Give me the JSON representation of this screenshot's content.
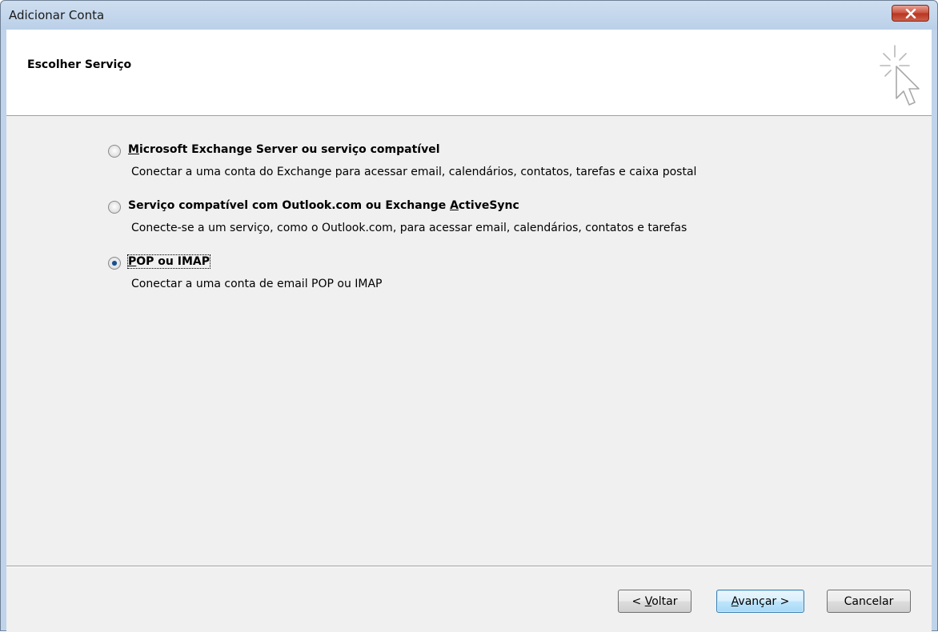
{
  "window": {
    "title": "Adicionar Conta"
  },
  "header": {
    "title": "Escolher Serviço"
  },
  "options": [
    {
      "label_pre": "",
      "label_key": "M",
      "label_post": "icrosoft Exchange Server ou serviço compatível",
      "description": "Conectar a uma conta do Exchange para acessar email, calendários, contatos, tarefas e caixa postal",
      "checked": false
    },
    {
      "label_pre": "Serviço compatível com Outlook.com ou Exchange ",
      "label_key": "A",
      "label_post": "ctiveSync",
      "description": "Conecte-se a um serviço, como o Outlook.com, para acessar email, calendários, contatos e tarefas",
      "checked": false
    },
    {
      "label_pre": "",
      "label_key": "P",
      "label_post": "OP ou IMAP",
      "description": "Conectar a uma conta de email POP ou IMAP",
      "checked": true
    }
  ],
  "buttons": {
    "back": {
      "pre": "< ",
      "key": "V",
      "post": "oltar"
    },
    "next": {
      "pre": "",
      "key": "A",
      "post": "vançar >"
    },
    "cancel": {
      "label": "Cancelar"
    }
  },
  "icons": {
    "close": "close-icon",
    "wizard": "sparkle-cursor-icon"
  },
  "colors": {
    "titlebar": "#bfd4ea",
    "close_button": "#c9503c",
    "client_bg": "#f0f0f0",
    "header_bg": "#ffffff",
    "default_button": "#a7d9f5"
  }
}
